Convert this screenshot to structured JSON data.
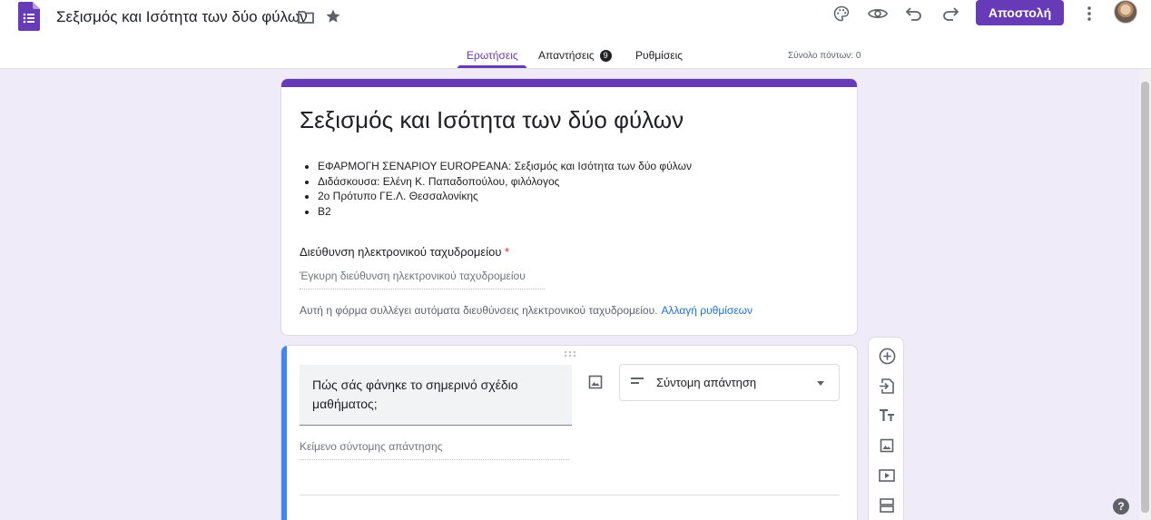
{
  "header": {
    "app_icon": "google-forms-icon",
    "title": "Σεξισμός και Ισότητα των δύο φύλων",
    "send_label": "Αποστολή",
    "icons": [
      "folder-icon",
      "star-icon",
      "palette-icon",
      "preview-eye-icon",
      "undo-icon",
      "redo-icon",
      "more-vert-icon"
    ]
  },
  "tabs": [
    {
      "label": "Ερωτήσεις",
      "active": true
    },
    {
      "label": "Απαντήσεις",
      "badge": "9"
    },
    {
      "label": "Ρυθμίσεις"
    }
  ],
  "total_points": "Σύνολο πόντων: 0",
  "form": {
    "title": "Σεξισμός και Ισότητα των δύο φύλων",
    "description": [
      "ΕΦΑΡΜΟΓΗ ΣΕΝΑΡΙΟΥ EUROPEANA: Σεξισμός και Ισότητα των δύο φύλων",
      "Διδάσκουσα: Ελένη Κ. Παπαδοπούλου, φιλόλογος",
      "2ο Πρότυπο ΓΕ.Λ. Θεσσαλονίκης",
      "Β2"
    ],
    "email_label": "Διεύθυνση ηλεκτρονικού ταχυδρομείου",
    "required_mark": "*",
    "email_placeholder": "Έγκυρη διεύθυνση ηλεκτρονικού ταχυδρομείου",
    "collect_note": "Αυτή η φόρμα συλλέγει αυτόματα διευθύνσεις ηλεκτρονικού ταχυδρομείου.",
    "change_settings_link": "Αλλαγή ρυθμίσεων"
  },
  "question": {
    "text": "Πώς σάς φάνηκε το σημερινό σχέδιο μαθήματος;",
    "type_label": "Σύντομη απάντηση",
    "answer_placeholder": "Κείμενο σύντομης απάντησης"
  },
  "side_toolbar": [
    "add-question-icon",
    "import-questions-icon",
    "add-title-icon",
    "add-image-icon",
    "add-video-icon",
    "add-section-icon"
  ],
  "colors": {
    "accent": "#673ab7",
    "background": "#f0ebf8",
    "question_bar": "#4285f4"
  }
}
